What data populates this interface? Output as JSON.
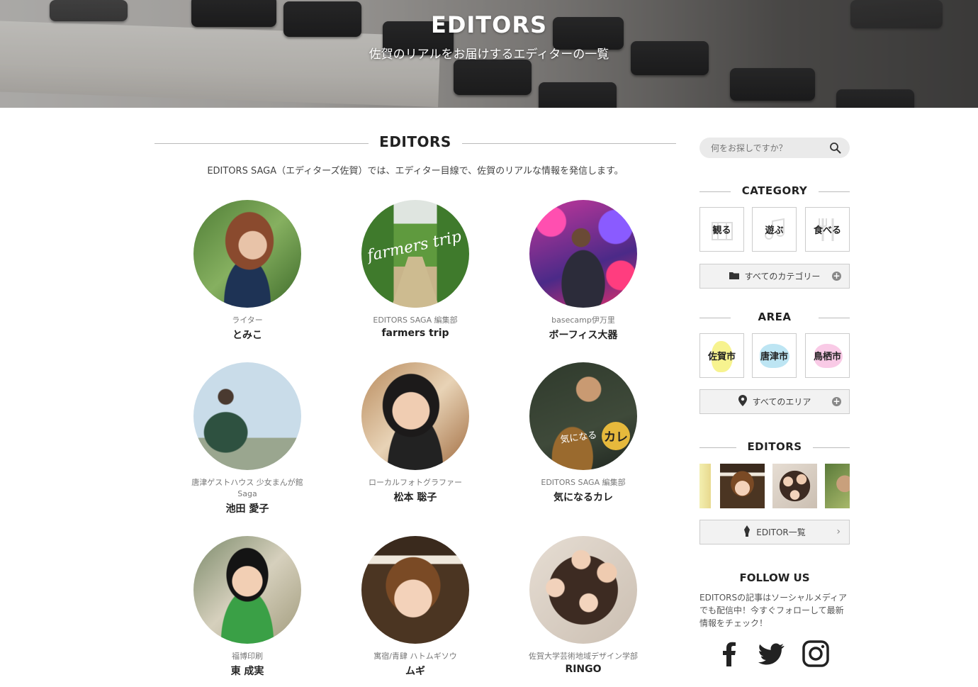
{
  "hero": {
    "title": "EDITORS",
    "subtitle": "佐賀のリアルをお届けするエディターの一覧"
  },
  "main": {
    "heading": "EDITORS",
    "intro": "EDITORS SAGA（エディターズ佐賀）では、エディター目線で、佐賀のリアルな情報を発信します。",
    "editors": [
      {
        "role": "ライター",
        "name": "とみこ"
      },
      {
        "role": "EDITORS SAGA 編集部",
        "name": "farmers trip",
        "avatar_text": "farmers trip"
      },
      {
        "role": "basecamp伊万里",
        "name": "ボーフィス大器"
      },
      {
        "role": "唐津ゲストハウス 少女まんが館",
        "role2": "Saga",
        "name": "池田 愛子"
      },
      {
        "role": "ローカルフォトグラファー",
        "name": "松本 聡子"
      },
      {
        "role": "EDITORS SAGA 編集部",
        "name": "気になるカレ",
        "avatar_text": "気になる",
        "avatar_badge": "カレ"
      },
      {
        "role": "福博印刷",
        "name": "東 成実"
      },
      {
        "role": "寓宿/青肆 ハトムギソウ",
        "name": "ムギ"
      },
      {
        "role": "佐賀大学芸術地域デザイン学部",
        "name": "RINGO"
      }
    ]
  },
  "sidebar": {
    "search_placeholder": "何をお探しですか？",
    "category": {
      "title": "CATEGORY",
      "tiles": [
        "観る",
        "遊ぶ",
        "食べる"
      ],
      "all_label": "すべてのカテゴリー"
    },
    "area": {
      "title": "AREA",
      "tiles": [
        "佐賀市",
        "唐津市",
        "鳥栖市"
      ],
      "all_label": "すべてのエリア"
    },
    "editors": {
      "title": "EDITORS",
      "list_label": "EDITOR一覧"
    },
    "follow": {
      "title": "FOLLOW US",
      "text": "EDITORSの記事はソーシャルメディアでも配信中！今すぐフォローして最新情報をチェック！"
    }
  }
}
